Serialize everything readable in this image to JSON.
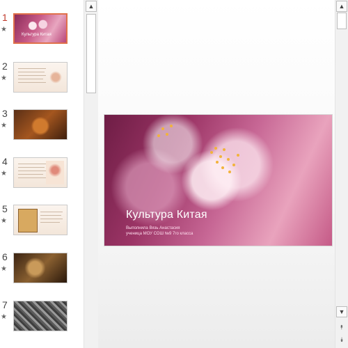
{
  "thumbnails": [
    {
      "number": "1",
      "title": "Культура Китая",
      "active": true
    },
    {
      "number": "2"
    },
    {
      "number": "3"
    },
    {
      "number": "4"
    },
    {
      "number": "5"
    },
    {
      "number": "6"
    },
    {
      "number": "7"
    }
  ],
  "star_icon": "★",
  "slide": {
    "title": "Культура Китая",
    "subtitle_line1": "Выполнила Вязь Анастасия",
    "subtitle_line2": "ученица МОУ СОШ №9 7го класса"
  },
  "icons": {
    "scroll_up": "▲",
    "scroll_down": "▼",
    "prev_slide": "⯭",
    "next_slide": "⯯"
  },
  "colors": {
    "active_number": "#c0392b",
    "active_border": "#e0704a"
  }
}
